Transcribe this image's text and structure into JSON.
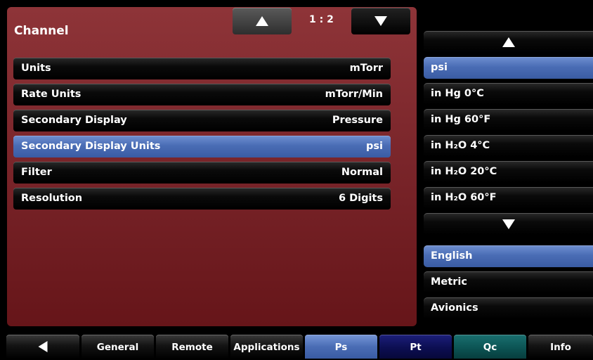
{
  "panel": {
    "title": "Channel",
    "page_indicator": "1 : 2"
  },
  "settings": [
    {
      "label": "Units",
      "value": "mTorr",
      "selected": false
    },
    {
      "label": "Rate Units",
      "value": "mTorr/Min",
      "selected": false
    },
    {
      "label": "Secondary Display",
      "value": "Pressure",
      "selected": false
    },
    {
      "label": "Secondary Display Units",
      "value": "psi",
      "selected": true
    },
    {
      "label": "Filter",
      "value": "Normal",
      "selected": false
    },
    {
      "label": "Resolution",
      "value": "6 Digits",
      "selected": false
    }
  ],
  "unit_list": [
    {
      "label": "psi",
      "selected": true
    },
    {
      "label": "in Hg 0°C",
      "selected": false
    },
    {
      "label": "in Hg 60°F",
      "selected": false
    },
    {
      "label": "in H₂O 4°C",
      "selected": false
    },
    {
      "label": "in H₂O 20°C",
      "selected": false
    },
    {
      "label": "in H₂O 60°F",
      "selected": false
    }
  ],
  "unit_systems": [
    {
      "label": "English",
      "selected": true
    },
    {
      "label": "Metric",
      "selected": false
    },
    {
      "label": "Avionics",
      "selected": false
    }
  ],
  "tabs": [
    {
      "label": "General"
    },
    {
      "label": "Remote"
    },
    {
      "label": "Applications"
    },
    {
      "label": "Ps"
    },
    {
      "label": "Pt"
    },
    {
      "label": "Qc"
    },
    {
      "label": "Info"
    }
  ],
  "colors": {
    "panel": "#7b262b",
    "selected": "#4a6db5",
    "tab_pt": "#0c0e52",
    "tab_qc": "#0c5454"
  }
}
